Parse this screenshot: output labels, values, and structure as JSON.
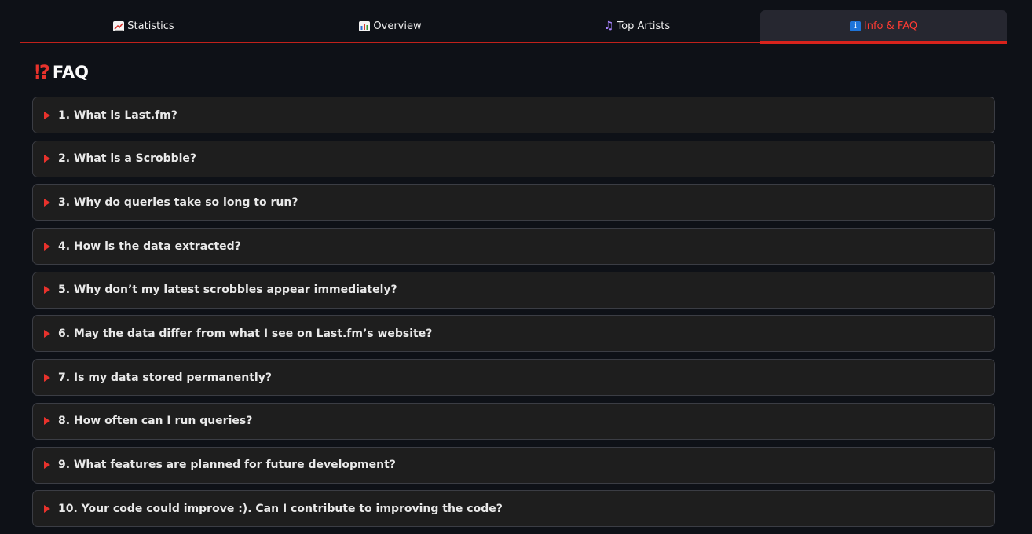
{
  "tabs": [
    {
      "label": "Statistics",
      "icon": "chart-increasing-icon",
      "active": false
    },
    {
      "label": "Overview",
      "icon": "bar-chart-icon",
      "active": false
    },
    {
      "label": "Top Artists",
      "icon": "musical-notes-icon",
      "active": false
    },
    {
      "label": "Info & FAQ",
      "icon": "information-icon",
      "active": true
    }
  ],
  "heading": {
    "icon": "⁉",
    "title": "FAQ"
  },
  "faq": [
    "1. What is Last.fm?",
    "2. What is a Scrobble?",
    "3. Why do queries take so long to run?",
    "4. How is the data extracted?",
    "5. Why don’t my latest scrobbles appear immediately?",
    "6. May the data differ from what I see on Last.fm’s website?",
    "7. Is my data stored permanently?",
    "8. How often can I run queries?",
    "9. What features are planned for future development?",
    "10. Your code could improve :). Can I contribute to improving the code?"
  ],
  "colors": {
    "accent": "#d9231c",
    "active_tab_text": "#ff3b33",
    "background": "#0e1117",
    "panel": "#1e1e1e",
    "border": "#3b3d44"
  }
}
